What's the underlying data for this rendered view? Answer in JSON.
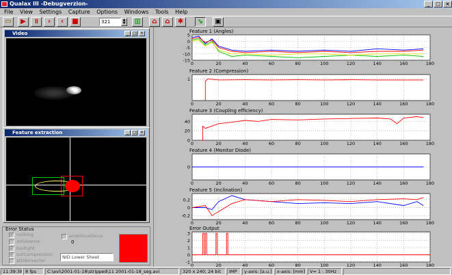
{
  "window": {
    "title": "Qualax III -Debugverzion-"
  },
  "menu": [
    "File",
    "View",
    "Settings",
    "Capture",
    "Options",
    "Windows",
    "Tools",
    "Help"
  ],
  "toolbar": {
    "frame_value": "321"
  },
  "video_panel": {
    "title": "Video"
  },
  "feature_panel": {
    "title": "Feature extraction"
  },
  "error_status": {
    "label": "Error Status",
    "checkboxes": [
      "nothing",
      "attidoerror",
      "badlight",
      "outCompression",
      "attidoreactor"
    ],
    "extra_checkbox": "ambitiousfocus",
    "count": "0",
    "dropdown_value": "NID Lower Sheet",
    "indicator_color": "#ff0000"
  },
  "status_bar": {
    "time": "11:39:38",
    "fps": "8 fps",
    "file": "C:\\avi\\2001-01-18\\stripped\\11 2001-01-18_seg.avi",
    "format": "320 x 240; 24 bit",
    "mode": "IMP",
    "y_axis": "y-axis: [a.u.]",
    "x_axis": "x-axis: [mm]",
    "speed": "V= 1 : 30Hz"
  },
  "chart_data": [
    {
      "type": "line",
      "title": "Feature 1 (Angles)",
      "xlim": [
        0,
        180
      ],
      "ylim": [
        -15,
        5
      ],
      "yticks": [
        5,
        0,
        -5,
        -10,
        -15
      ],
      "xticks": [
        0,
        20,
        40,
        60,
        80,
        100,
        120,
        140,
        160,
        180
      ],
      "series": [
        {
          "color": "#0000ff",
          "x": [
            0,
            5,
            10,
            15,
            20,
            30,
            40,
            60,
            80,
            100,
            120,
            140,
            160,
            175
          ],
          "values": [
            3,
            4,
            -2,
            2,
            -4,
            -7,
            -8,
            -7,
            -8,
            -7,
            -8,
            -6,
            -7,
            -6
          ]
        },
        {
          "color": "#ff0000",
          "x": [
            0,
            5,
            10,
            15,
            20,
            30,
            40,
            60,
            80,
            100,
            120,
            140,
            160,
            175
          ],
          "values": [
            2,
            3,
            -1,
            1,
            -5,
            -8,
            -9,
            -8,
            -9,
            -8,
            -9,
            -8,
            -8,
            -7
          ]
        },
        {
          "color": "#00c000",
          "x": [
            0,
            5,
            10,
            15,
            20,
            30,
            40,
            60,
            80,
            100,
            120,
            140,
            160,
            175
          ],
          "values": [
            1,
            2,
            -3,
            0,
            -8,
            -12,
            -11,
            -12,
            -13,
            -12,
            -11,
            -12,
            -11,
            -12
          ]
        },
        {
          "color": "#e0e000",
          "x": [
            0,
            5,
            10,
            15,
            20,
            30,
            40,
            60,
            80,
            100,
            120,
            140,
            160,
            175
          ],
          "values": [
            0,
            1,
            -4,
            -1,
            -7,
            -10,
            -10,
            -11,
            -10,
            -10,
            -11,
            -10,
            -10,
            -10
          ]
        }
      ]
    },
    {
      "type": "line",
      "title": "Feature 2 (Compression)",
      "xlim": [
        0,
        180
      ],
      "ylim": [
        0,
        1.2
      ],
      "yticks": [
        1
      ],
      "xticks": [
        0,
        20,
        40,
        60,
        80,
        100,
        120,
        140,
        160,
        180
      ],
      "series": [
        {
          "color": "#ff0000",
          "x": [
            10,
            10,
            12,
            20,
            40,
            60,
            80,
            100,
            120,
            140,
            160,
            175
          ],
          "values": [
            0,
            0.9,
            1,
            0.95,
            0.96,
            0.95,
            0.96,
            0.95,
            0.96,
            0.95,
            0.95,
            0.95
          ]
        }
      ]
    },
    {
      "type": "line",
      "title": "Feature 3 (Coupling efficiency)",
      "xlim": [
        0,
        180
      ],
      "ylim": [
        0,
        55
      ],
      "yticks": [
        40,
        20,
        0
      ],
      "xticks": [
        0,
        20,
        40,
        60,
        80,
        100,
        120,
        140,
        160,
        180
      ],
      "series": [
        {
          "color": "#ff0000",
          "x": [
            8,
            8,
            10,
            20,
            30,
            40,
            50,
            60,
            80,
            100,
            120,
            140,
            150,
            155,
            160,
            170,
            175
          ],
          "values": [
            0,
            30,
            25,
            35,
            38,
            42,
            40,
            44,
            43,
            45,
            46,
            47,
            45,
            35,
            47,
            50,
            48
          ]
        }
      ]
    },
    {
      "type": "line",
      "title": "Feature 4 (Monitor Diode)",
      "xlim": [
        0,
        180
      ],
      "ylim": [
        -1,
        1
      ],
      "yticks": [
        0
      ],
      "xticks": [
        0,
        20,
        40,
        60,
        80,
        100,
        120,
        140,
        160,
        180
      ],
      "series": [
        {
          "color": "#0000ff",
          "x": [
            0,
            175
          ],
          "values": [
            0,
            0
          ]
        }
      ]
    },
    {
      "type": "line",
      "title": "Feature 5 (Inclination)",
      "xlim": [
        0,
        180
      ],
      "ylim": [
        -0.3,
        0.35
      ],
      "yticks": [
        0.2,
        0,
        -0.2
      ],
      "xticks": [
        0,
        20,
        40,
        60,
        80,
        100,
        120,
        140,
        160,
        180
      ],
      "series": [
        {
          "color": "#0000ff",
          "x": [
            0,
            10,
            15,
            20,
            30,
            40,
            60,
            80,
            100,
            120,
            140,
            160,
            170,
            175
          ],
          "values": [
            0,
            0,
            -0.05,
            0.15,
            0.3,
            0.2,
            0.15,
            0.1,
            0.12,
            0.1,
            0.15,
            0.05,
            0.15,
            0.05
          ]
        },
        {
          "color": "#ff0000",
          "x": [
            0,
            10,
            15,
            20,
            30,
            40,
            60,
            80,
            100,
            120,
            140,
            160,
            170,
            175
          ],
          "values": [
            0,
            0.05,
            -0.2,
            -0.1,
            0.1,
            0.2,
            0.15,
            0.2,
            0.18,
            0.15,
            0.2,
            0.22,
            0.2,
            0.25
          ]
        }
      ]
    },
    {
      "type": "line",
      "title": "Error Output",
      "xlim": [
        0,
        180
      ],
      "ylim": [
        -1,
        3.2
      ],
      "yticks": [
        3,
        2,
        1,
        0,
        -1
      ],
      "xticks": [
        0,
        20,
        40,
        60,
        80,
        100,
        120,
        140,
        160,
        180
      ],
      "series": [
        {
          "color": "#ff0000",
          "x": [
            0,
            8,
            8,
            9,
            9,
            10,
            10,
            11,
            11,
            18,
            18,
            19,
            19,
            26,
            26,
            27,
            27,
            180
          ],
          "values": [
            0,
            0,
            3,
            3,
            0,
            0,
            3,
            3,
            0,
            0,
            3,
            3,
            0,
            0,
            3,
            3,
            0,
            0
          ]
        }
      ]
    }
  ]
}
